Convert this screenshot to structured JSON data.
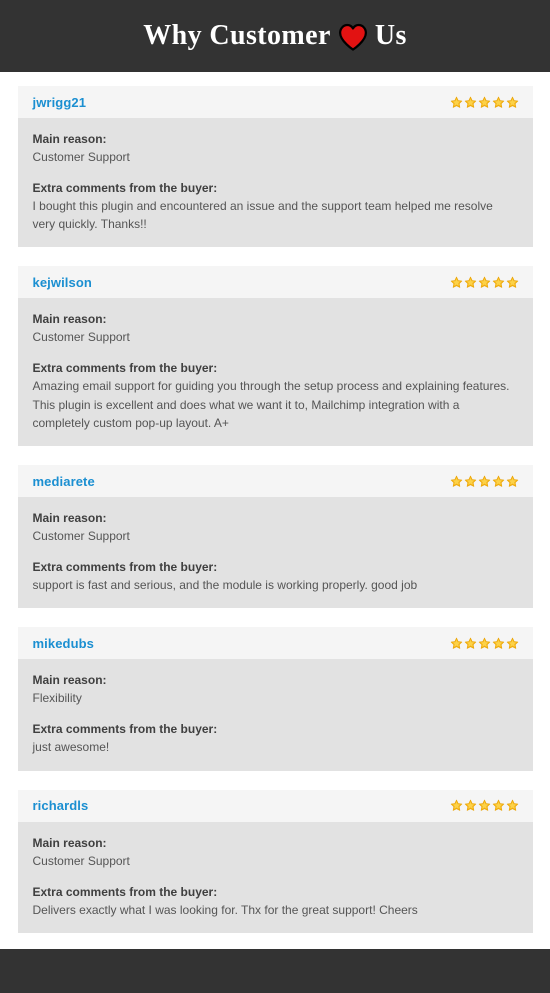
{
  "banner": {
    "title_before": "Why Customer",
    "heart_icon": "heart-icon",
    "title_after": "Us",
    "background_color": "#333333",
    "text_color": "#ffffff",
    "heart_color": "#e21212"
  },
  "labels": {
    "main_reason": "Main reason:",
    "extra_comments": "Extra comments from the buyer:"
  },
  "colors": {
    "username": "#1b8fd1",
    "star": "#f6b516",
    "card_header_bg": "#f5f5f5",
    "card_body_bg": "#e2e2e2",
    "page_bg": "#ffffff"
  },
  "reviews": [
    {
      "username": "jwrigg21",
      "rating": 5,
      "rating_text": "5 out of 5 stars",
      "main_reason": "Customer Support",
      "comment": "I bought this plugin and encountered an issue and the support team helped me resolve very quickly. Thanks!!"
    },
    {
      "username": "kejwilson",
      "rating": 5,
      "rating_text": "5 out of 5 stars",
      "main_reason": "Customer Support",
      "comment": "Amazing email support for guiding you through the setup process and explaining features. This plugin is excellent and does what we want it to, Mailchimp integration with a completely custom pop-up layout. A+"
    },
    {
      "username": "mediarete",
      "rating": 5,
      "rating_text": "5 out of 5 stars",
      "main_reason": "Customer Support",
      "comment": "support is fast and serious, and the module is working properly. good job"
    },
    {
      "username": "mikedubs",
      "rating": 5,
      "rating_text": "5 out of 5 stars",
      "main_reason": "Flexibility",
      "comment": "just awesome!"
    },
    {
      "username": "richardls",
      "rating": 5,
      "rating_text": "5 out of 5 stars",
      "main_reason": "Customer Support",
      "comment": "Delivers exactly what I was looking for. Thx for the great support! Cheers"
    }
  ]
}
